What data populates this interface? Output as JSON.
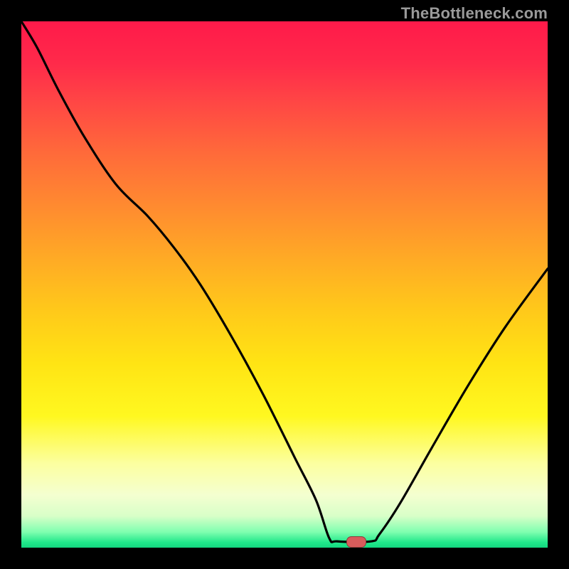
{
  "watermark": "TheBottleneck.com",
  "marker": {
    "x_frac": 0.635,
    "y_frac": 0.988
  },
  "chart_data": {
    "type": "line",
    "title": "",
    "xlabel": "",
    "ylabel": "",
    "xlim": [
      0,
      1
    ],
    "ylim": [
      0,
      1
    ],
    "series": [
      {
        "name": "curve",
        "x": [
          0.0,
          0.03,
          0.07,
          0.12,
          0.18,
          0.24,
          0.29,
          0.34,
          0.4,
          0.46,
          0.52,
          0.56,
          0.585,
          0.6,
          0.665,
          0.68,
          0.72,
          0.78,
          0.85,
          0.92,
          1.0
        ],
        "y": [
          1.0,
          0.95,
          0.87,
          0.78,
          0.69,
          0.63,
          0.57,
          0.5,
          0.4,
          0.29,
          0.17,
          0.09,
          0.018,
          0.012,
          0.012,
          0.025,
          0.085,
          0.19,
          0.31,
          0.42,
          0.53
        ]
      }
    ],
    "gradient_stops": [
      {
        "pos": 0.0,
        "color": "#ff1a4a"
      },
      {
        "pos": 0.25,
        "color": "#ff6a3a"
      },
      {
        "pos": 0.55,
        "color": "#ffc91a"
      },
      {
        "pos": 0.84,
        "color": "#fcffa0"
      },
      {
        "pos": 0.97,
        "color": "#80ffb0"
      },
      {
        "pos": 1.0,
        "color": "#14d680"
      }
    ]
  }
}
